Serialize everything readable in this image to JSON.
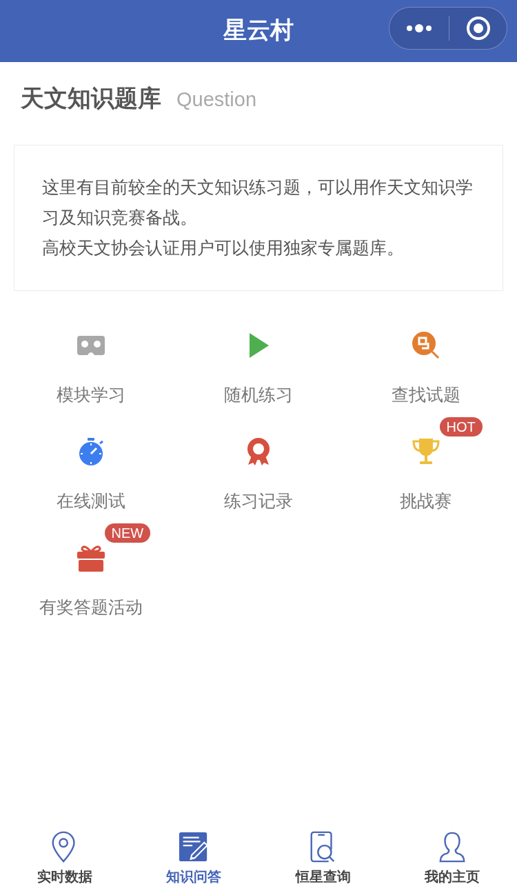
{
  "header": {
    "title": "星云村"
  },
  "section": {
    "title": "天文知识题库",
    "subtitle": "Question"
  },
  "intro": {
    "lines": [
      "这里有目前较全的天文知识练习题，可以用作天文知识学习及知识竞赛备战。",
      "高校天文协会认证用户可以使用独家专属题库。"
    ]
  },
  "features": [
    {
      "label": "模块学习",
      "kind": "vr",
      "color": "#a8a8a8"
    },
    {
      "label": "随机练习",
      "kind": "play",
      "color": "#4fae4f"
    },
    {
      "label": "查找试题",
      "kind": "search",
      "color": "#e27d30"
    },
    {
      "label": "在线测试",
      "kind": "stopwatch",
      "color": "#3c7ef0"
    },
    {
      "label": "练习记录",
      "kind": "medal",
      "color": "#d6503f"
    },
    {
      "label": "挑战赛",
      "kind": "trophy",
      "color": "#efbd3d",
      "badge": "HOT"
    },
    {
      "label": "有奖答题活动",
      "kind": "gift",
      "color": "#d6503f",
      "badge": "NEW"
    }
  ],
  "tabs": [
    {
      "label": "实时数据",
      "kind": "pin",
      "selected": false
    },
    {
      "label": "知识问答",
      "kind": "note",
      "selected": true
    },
    {
      "label": "恒星查询",
      "kind": "phone",
      "selected": false
    },
    {
      "label": "我的主页",
      "kind": "user",
      "selected": false
    }
  ]
}
